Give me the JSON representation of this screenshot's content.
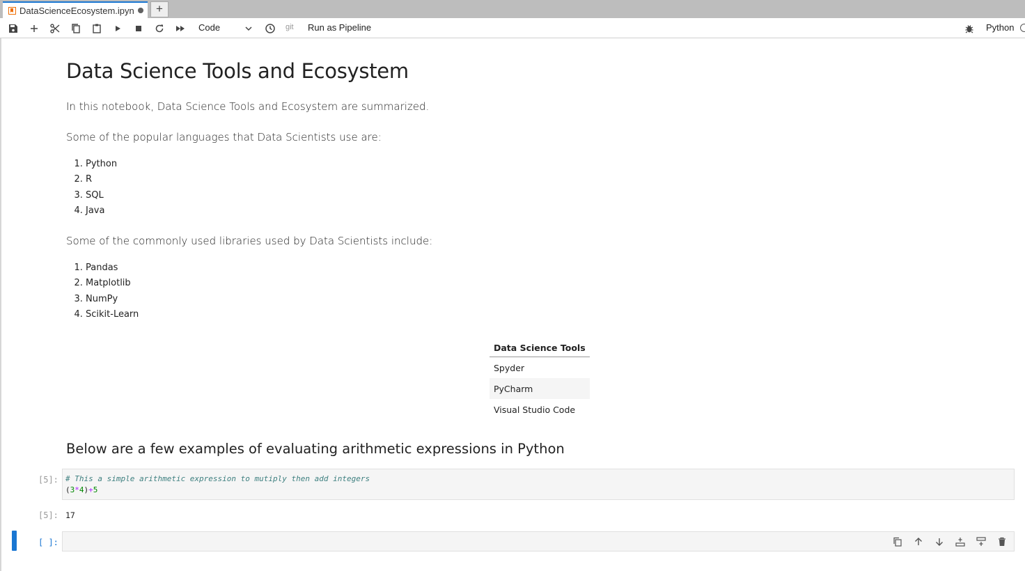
{
  "tab": {
    "title": "DataScienceEcosystem.ipyn",
    "new_tab_label": "+"
  },
  "toolbar": {
    "cell_type": "Code",
    "git_label": "git",
    "run_pipeline": "Run as Pipeline",
    "kernel_name": "Python",
    "icons": [
      "save-icon",
      "add-icon",
      "cut-icon",
      "copy-icon",
      "paste-icon",
      "run-icon",
      "stop-icon",
      "restart-icon",
      "fast-forward-icon",
      "clock-icon",
      "bug-icon"
    ]
  },
  "notebook": {
    "title": "Data Science Tools and Ecosystem",
    "intro": "In this notebook, Data Science Tools and Ecosystem are summarized.",
    "languages_heading": "Some of the popular languages that Data Scientists use are:",
    "languages": [
      "Python",
      "R",
      "SQL",
      "Java"
    ],
    "libraries_heading": "Some of the commonly used libraries used by Data Scientists include:",
    "libraries": [
      "Pandas",
      "Matplotlib",
      "NumPy",
      "Scikit-Learn"
    ],
    "tools_table": {
      "header": "Data Science Tools",
      "rows": [
        "Spyder",
        "PyCharm",
        "Visual Studio Code"
      ]
    },
    "examples_heading": "Below are a few examples of evaluating arithmetic expressions in Python",
    "code_cell": {
      "prompt": "[5]:",
      "comment": "# This a simple arithmetic expression to mutiply then add integers",
      "code_parts": [
        "(",
        "3",
        "*",
        "4",
        ")",
        "+",
        "5"
      ],
      "output_prompt": "[5]:",
      "output": "17"
    },
    "empty_cell": {
      "prompt": "[ ]:"
    }
  },
  "colors": {
    "accent": "#1976d2",
    "cell_bg": "#f5f5f5",
    "comment": "#3d7f7f",
    "number": "#008800",
    "operator": "#aa22ff"
  }
}
